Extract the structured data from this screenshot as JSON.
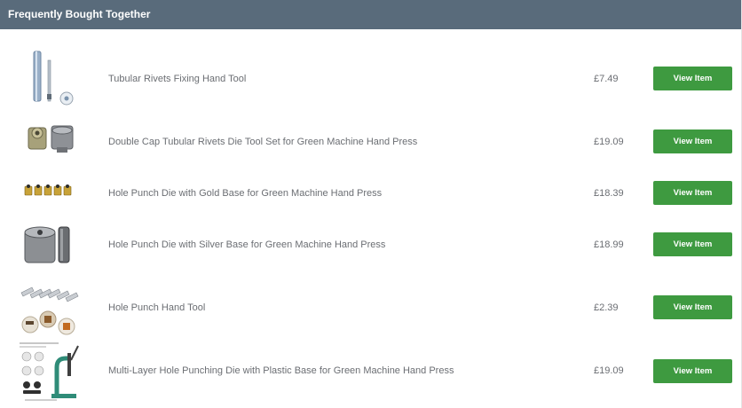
{
  "section": {
    "title": "Frequently Bought Together"
  },
  "products": [
    {
      "name": "Tubular Rivets Fixing Hand Tool",
      "price": "£7.49",
      "button": "View Item",
      "thumbnail": "rivet-fixing-tool-image"
    },
    {
      "name": "Double Cap Tubular Rivets Die Tool Set for Green Machine Hand Press",
      "price": "£19.09",
      "button": "View Item",
      "thumbnail": "double-cap-die-set-image"
    },
    {
      "name": "Hole Punch Die with Gold Base for Green Machine Hand Press",
      "price": "£18.39",
      "button": "View Item",
      "thumbnail": "gold-base-punch-dies-image"
    },
    {
      "name": "Hole Punch Die with Silver Base for Green Machine Hand Press",
      "price": "£18.99",
      "button": "View Item",
      "thumbnail": "silver-base-punch-die-image"
    },
    {
      "name": "Hole Punch Hand Tool",
      "price": "£2.39",
      "button": "View Item",
      "thumbnail": "hole-punch-hand-tool-image"
    },
    {
      "name": "Multi-Layer Hole Punching Die with Plastic Base for Green Machine Hand Press",
      "price": "£19.09",
      "button": "View Item",
      "thumbnail": "multi-layer-die-press-image"
    }
  ],
  "colors": {
    "header_bg": "#596b7b",
    "button_bg": "#3e9a40",
    "text": "#6b6e73"
  }
}
